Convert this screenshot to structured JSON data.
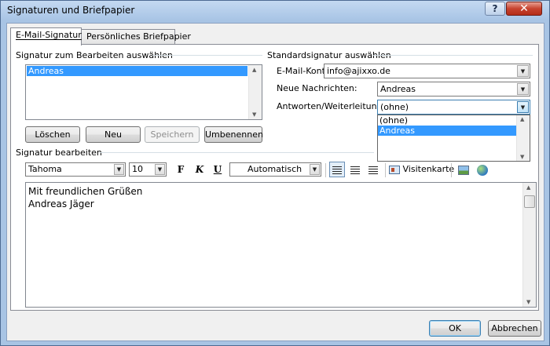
{
  "window": {
    "title": "Signaturen und Briefpapier",
    "help_label": "?",
    "close_label": "✕"
  },
  "tabs": [
    {
      "label": "E-Mail-Signatur"
    },
    {
      "label": "Persönliches Briefpapier"
    }
  ],
  "signature_select": {
    "group_label": "Signatur zum Bearbeiten auswählen",
    "items": [
      "Andreas"
    ],
    "selected": "Andreas",
    "buttons": {
      "delete": "Löschen",
      "new": "Neu",
      "save": "Speichern",
      "rename": "Umbenennen"
    }
  },
  "default_signature": {
    "group_label": "Standardsignatur auswählen",
    "account_label": "E-Mail-Konto:",
    "account_value": "info@ajixxo.de",
    "new_messages_label": "Neue Nachrichten:",
    "new_messages_value": "Andreas",
    "replies_label": "Antworten/Weiterleitungen:",
    "replies_value": "(ohne)",
    "replies_options": [
      "(ohne)",
      "Andreas"
    ],
    "replies_highlighted": "Andreas"
  },
  "editor": {
    "group_label": "Signatur bearbeiten",
    "font": "Tahoma",
    "size": "10",
    "bold_label": "F",
    "italic_label": "K",
    "underline_label": "U",
    "color": "Automatisch",
    "business_card_label": "Visitenkarte",
    "lines": [
      "Mit freundlichen Grüßen",
      "Andreas Jäger"
    ]
  },
  "footer": {
    "ok": "OK",
    "cancel": "Abbrechen"
  },
  "icons": {
    "picture": "picture-icon",
    "hyperlink": "hyperlink-icon",
    "business_card": "business-card-icon"
  },
  "colors": {
    "selection": "#3399ff",
    "close_button": "#c7432f",
    "title_bar": "#b9d1ea"
  }
}
